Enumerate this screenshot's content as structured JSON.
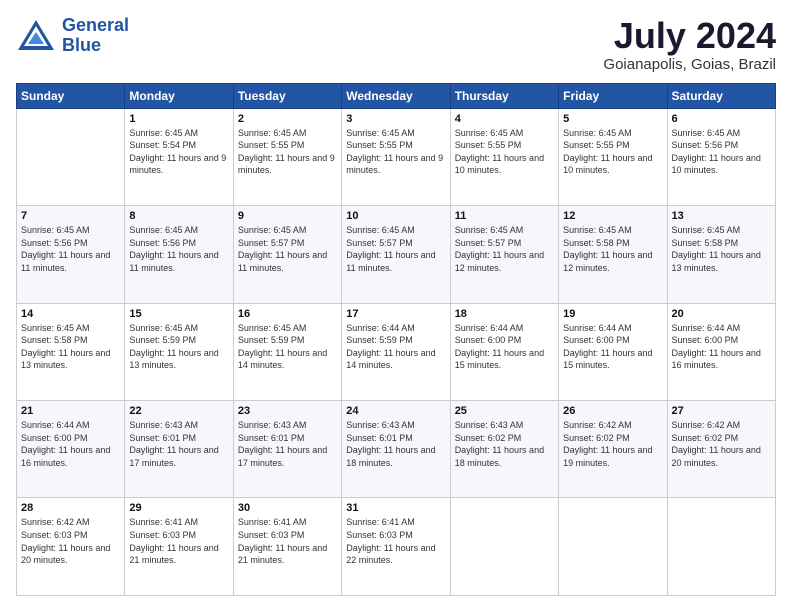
{
  "logo": {
    "line1": "General",
    "line2": "Blue"
  },
  "header": {
    "title": "July 2024",
    "subtitle": "Goianapolis, Goias, Brazil"
  },
  "days_of_week": [
    "Sunday",
    "Monday",
    "Tuesday",
    "Wednesday",
    "Thursday",
    "Friday",
    "Saturday"
  ],
  "weeks": [
    [
      {
        "num": "",
        "sunrise": "",
        "sunset": "",
        "daylight": ""
      },
      {
        "num": "1",
        "sunrise": "Sunrise: 6:45 AM",
        "sunset": "Sunset: 5:54 PM",
        "daylight": "Daylight: 11 hours and 9 minutes."
      },
      {
        "num": "2",
        "sunrise": "Sunrise: 6:45 AM",
        "sunset": "Sunset: 5:55 PM",
        "daylight": "Daylight: 11 hours and 9 minutes."
      },
      {
        "num": "3",
        "sunrise": "Sunrise: 6:45 AM",
        "sunset": "Sunset: 5:55 PM",
        "daylight": "Daylight: 11 hours and 9 minutes."
      },
      {
        "num": "4",
        "sunrise": "Sunrise: 6:45 AM",
        "sunset": "Sunset: 5:55 PM",
        "daylight": "Daylight: 11 hours and 10 minutes."
      },
      {
        "num": "5",
        "sunrise": "Sunrise: 6:45 AM",
        "sunset": "Sunset: 5:55 PM",
        "daylight": "Daylight: 11 hours and 10 minutes."
      },
      {
        "num": "6",
        "sunrise": "Sunrise: 6:45 AM",
        "sunset": "Sunset: 5:56 PM",
        "daylight": "Daylight: 11 hours and 10 minutes."
      }
    ],
    [
      {
        "num": "7",
        "sunrise": "Sunrise: 6:45 AM",
        "sunset": "Sunset: 5:56 PM",
        "daylight": "Daylight: 11 hours and 11 minutes."
      },
      {
        "num": "8",
        "sunrise": "Sunrise: 6:45 AM",
        "sunset": "Sunset: 5:56 PM",
        "daylight": "Daylight: 11 hours and 11 minutes."
      },
      {
        "num": "9",
        "sunrise": "Sunrise: 6:45 AM",
        "sunset": "Sunset: 5:57 PM",
        "daylight": "Daylight: 11 hours and 11 minutes."
      },
      {
        "num": "10",
        "sunrise": "Sunrise: 6:45 AM",
        "sunset": "Sunset: 5:57 PM",
        "daylight": "Daylight: 11 hours and 11 minutes."
      },
      {
        "num": "11",
        "sunrise": "Sunrise: 6:45 AM",
        "sunset": "Sunset: 5:57 PM",
        "daylight": "Daylight: 11 hours and 12 minutes."
      },
      {
        "num": "12",
        "sunrise": "Sunrise: 6:45 AM",
        "sunset": "Sunset: 5:58 PM",
        "daylight": "Daylight: 11 hours and 12 minutes."
      },
      {
        "num": "13",
        "sunrise": "Sunrise: 6:45 AM",
        "sunset": "Sunset: 5:58 PM",
        "daylight": "Daylight: 11 hours and 13 minutes."
      }
    ],
    [
      {
        "num": "14",
        "sunrise": "Sunrise: 6:45 AM",
        "sunset": "Sunset: 5:58 PM",
        "daylight": "Daylight: 11 hours and 13 minutes."
      },
      {
        "num": "15",
        "sunrise": "Sunrise: 6:45 AM",
        "sunset": "Sunset: 5:59 PM",
        "daylight": "Daylight: 11 hours and 13 minutes."
      },
      {
        "num": "16",
        "sunrise": "Sunrise: 6:45 AM",
        "sunset": "Sunset: 5:59 PM",
        "daylight": "Daylight: 11 hours and 14 minutes."
      },
      {
        "num": "17",
        "sunrise": "Sunrise: 6:44 AM",
        "sunset": "Sunset: 5:59 PM",
        "daylight": "Daylight: 11 hours and 14 minutes."
      },
      {
        "num": "18",
        "sunrise": "Sunrise: 6:44 AM",
        "sunset": "Sunset: 6:00 PM",
        "daylight": "Daylight: 11 hours and 15 minutes."
      },
      {
        "num": "19",
        "sunrise": "Sunrise: 6:44 AM",
        "sunset": "Sunset: 6:00 PM",
        "daylight": "Daylight: 11 hours and 15 minutes."
      },
      {
        "num": "20",
        "sunrise": "Sunrise: 6:44 AM",
        "sunset": "Sunset: 6:00 PM",
        "daylight": "Daylight: 11 hours and 16 minutes."
      }
    ],
    [
      {
        "num": "21",
        "sunrise": "Sunrise: 6:44 AM",
        "sunset": "Sunset: 6:00 PM",
        "daylight": "Daylight: 11 hours and 16 minutes."
      },
      {
        "num": "22",
        "sunrise": "Sunrise: 6:43 AM",
        "sunset": "Sunset: 6:01 PM",
        "daylight": "Daylight: 11 hours and 17 minutes."
      },
      {
        "num": "23",
        "sunrise": "Sunrise: 6:43 AM",
        "sunset": "Sunset: 6:01 PM",
        "daylight": "Daylight: 11 hours and 17 minutes."
      },
      {
        "num": "24",
        "sunrise": "Sunrise: 6:43 AM",
        "sunset": "Sunset: 6:01 PM",
        "daylight": "Daylight: 11 hours and 18 minutes."
      },
      {
        "num": "25",
        "sunrise": "Sunrise: 6:43 AM",
        "sunset": "Sunset: 6:02 PM",
        "daylight": "Daylight: 11 hours and 18 minutes."
      },
      {
        "num": "26",
        "sunrise": "Sunrise: 6:42 AM",
        "sunset": "Sunset: 6:02 PM",
        "daylight": "Daylight: 11 hours and 19 minutes."
      },
      {
        "num": "27",
        "sunrise": "Sunrise: 6:42 AM",
        "sunset": "Sunset: 6:02 PM",
        "daylight": "Daylight: 11 hours and 20 minutes."
      }
    ],
    [
      {
        "num": "28",
        "sunrise": "Sunrise: 6:42 AM",
        "sunset": "Sunset: 6:03 PM",
        "daylight": "Daylight: 11 hours and 20 minutes."
      },
      {
        "num": "29",
        "sunrise": "Sunrise: 6:41 AM",
        "sunset": "Sunset: 6:03 PM",
        "daylight": "Daylight: 11 hours and 21 minutes."
      },
      {
        "num": "30",
        "sunrise": "Sunrise: 6:41 AM",
        "sunset": "Sunset: 6:03 PM",
        "daylight": "Daylight: 11 hours and 21 minutes."
      },
      {
        "num": "31",
        "sunrise": "Sunrise: 6:41 AM",
        "sunset": "Sunset: 6:03 PM",
        "daylight": "Daylight: 11 hours and 22 minutes."
      },
      {
        "num": "",
        "sunrise": "",
        "sunset": "",
        "daylight": ""
      },
      {
        "num": "",
        "sunrise": "",
        "sunset": "",
        "daylight": ""
      },
      {
        "num": "",
        "sunrise": "",
        "sunset": "",
        "daylight": ""
      }
    ]
  ]
}
